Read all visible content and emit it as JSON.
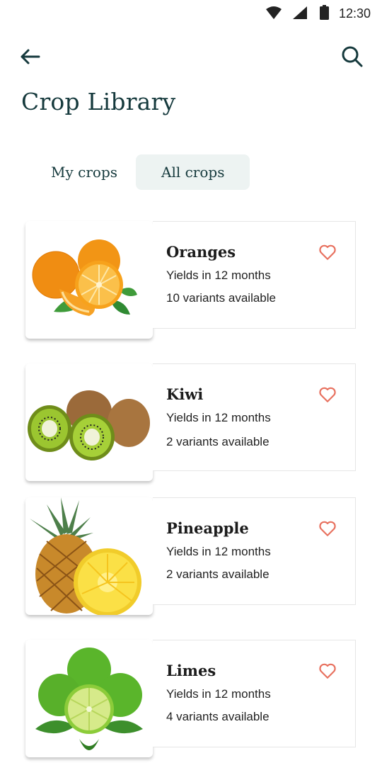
{
  "status_bar": {
    "time": "12:30",
    "icons": [
      "wifi-icon",
      "cell-signal-icon",
      "battery-icon"
    ]
  },
  "top_bar": {
    "back_icon": "arrow-left-icon",
    "search_icon": "search-icon"
  },
  "page": {
    "title": "Crop Library"
  },
  "tabs": [
    {
      "label": "My crops",
      "active": false
    },
    {
      "label": "All crops",
      "active": true
    }
  ],
  "crops": [
    {
      "name": "Oranges",
      "yield": "Yields in 12 months",
      "variants": "10 variants available",
      "favorite_icon": "heart-outline-icon"
    },
    {
      "name": "Kiwi",
      "yield": "Yields in 12 months",
      "variants": "2 variants available",
      "favorite_icon": "heart-outline-icon"
    },
    {
      "name": "Pineapple",
      "yield": "Yields in 12 months",
      "variants": "2 variants available",
      "favorite_icon": "heart-outline-icon"
    },
    {
      "name": "Limes",
      "yield": "Yields in 12 months",
      "variants": "4 variants available",
      "favorite_icon": "heart-outline-icon"
    }
  ],
  "colors": {
    "title": "#163a3d",
    "active_tab_bg": "#edf3f2",
    "heart": "#e8715f"
  }
}
